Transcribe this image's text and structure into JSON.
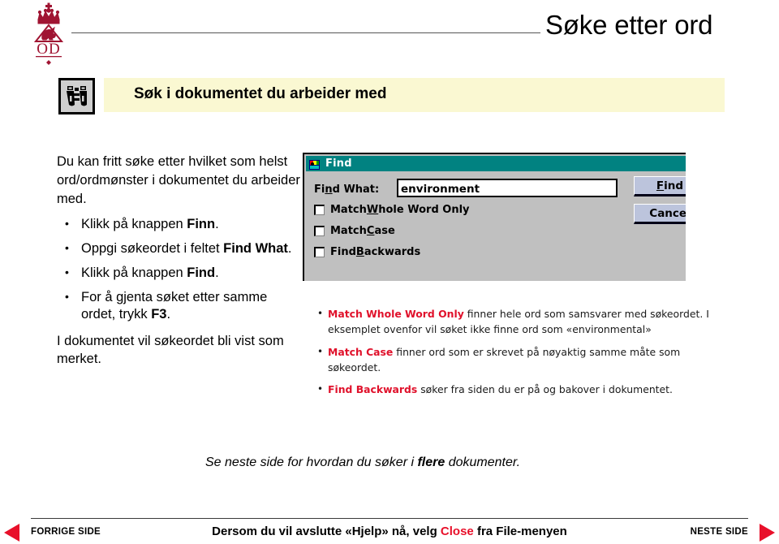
{
  "header": {
    "title": "Søke etter ord",
    "logo_alt": "od-crest-logo",
    "logo_text": "OD"
  },
  "section": {
    "icon": "binoculars-icon",
    "heading": "Søk i dokumentet du arbeider med"
  },
  "left_column": {
    "intro": "Du kan fritt søke etter hvilket som helst ord/ordmønster i dokumentet du arbeider med.",
    "bullets": [
      {
        "pre": "Klikk på knappen ",
        "bold": "Finn",
        "post": "."
      },
      {
        "pre": "Oppgi søkeordet i feltet ",
        "bold": "Find What",
        "post": "."
      },
      {
        "pre": "Klikk på knappen ",
        "bold": "Find",
        "post": "."
      },
      {
        "pre": "For å gjenta søket etter samme ordet, trykk ",
        "bold": "F3",
        "post": "."
      }
    ],
    "closing": "I dokumentet vil søkeordet bli vist som merket.",
    "bullet_glyph": "•"
  },
  "find_dialog": {
    "title": "Find",
    "title_icon": "find-app-icon",
    "find_what_label_pre": "Fi",
    "find_what_label_accel": "n",
    "find_what_label_post": "d What:",
    "find_what_value": "environment",
    "checkboxes": [
      {
        "pre": "Match ",
        "accel": "W",
        "post": "hole Word Only",
        "checked": false
      },
      {
        "pre": "Match ",
        "accel": "C",
        "post": "ase",
        "checked": false
      },
      {
        "pre": "Find ",
        "accel": "B",
        "post": "ackwards",
        "checked": false
      }
    ],
    "buttons": [
      {
        "pre": "",
        "accel": "F",
        "post": "ind"
      },
      {
        "pre": "",
        "accel": "",
        "post": "Cancel"
      }
    ],
    "titlebar_color": "#018281",
    "face_color": "#c0c0c0",
    "button_color": "#bcc4dc"
  },
  "right_column": {
    "bullet_glyph": "•",
    "items": [
      {
        "term": "Match Whole Word Only",
        "text": " finner hele ord som samsvarer med søkeordet. I eksemplet ovenfor vil søket ikke finne ord som «environmental»"
      },
      {
        "term": "Match Case",
        "text": " finner ord som er skrevet på nøyaktig samme måte som søkeordet."
      },
      {
        "term": "Find Backwards",
        "text": " søker fra siden du er på og bakover i dokumentet."
      }
    ],
    "accent_color": "#e0112b"
  },
  "bottom_note": {
    "pre": "Se neste side for hvordan du søker i ",
    "bold": "flere",
    "post": " dokumenter."
  },
  "footer": {
    "prev_label": "FORRIGE SIDE",
    "next_label": "NESTE SIDE",
    "center_pre": "Dersom du vil avslutte «Hjelp» nå, velg ",
    "center_accent": "Close",
    "center_post": " fra File-menyen",
    "arrow_color": "#e8102a"
  }
}
